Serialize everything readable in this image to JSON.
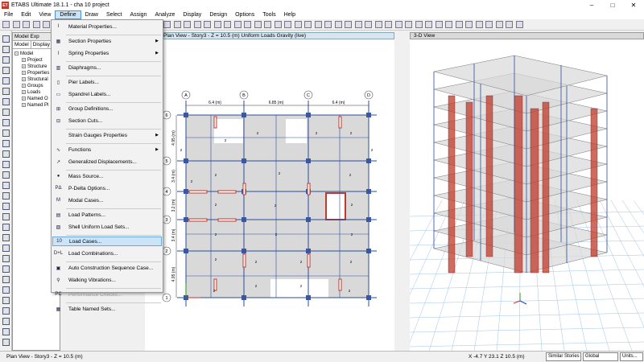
{
  "window": {
    "title": "ETABS Ultimate 18.1.1 - cha 10 project",
    "logo_text": "ET"
  },
  "menubar": [
    "File",
    "Edit",
    "View",
    "Define",
    "Draw",
    "Select",
    "Assign",
    "Analyze",
    "Display",
    "Design",
    "Options",
    "Tools",
    "Help"
  ],
  "model_panel": {
    "title": "Model Exp",
    "tabs": [
      "Model",
      "Display"
    ],
    "tree": [
      "Model",
      "Project",
      "Structure",
      "Properties",
      "Structural",
      "Groups",
      "Loads",
      "Named O",
      "Named Pl"
    ]
  },
  "define_menu": [
    {
      "label": "Material Properties...",
      "icon": "I",
      "submenu": false
    },
    {
      "label": "Section Properties",
      "icon": "▦",
      "submenu": true
    },
    {
      "label": "Spring Properties",
      "icon": "⌇",
      "submenu": true
    },
    {
      "label": "Diaphragms...",
      "icon": "▥",
      "submenu": false
    },
    {
      "label": "Pier Labels...",
      "icon": "▯",
      "submenu": false
    },
    {
      "label": "Spandrel Labels...",
      "icon": "▭",
      "submenu": false
    },
    {
      "label": "Group Definitions...",
      "icon": "⊞",
      "submenu": false
    },
    {
      "label": "Section Cuts...",
      "icon": "⊟",
      "submenu": false
    },
    {
      "label": "Strain Gauges Properties",
      "icon": "",
      "submenu": true
    },
    {
      "label": "Functions",
      "icon": "∿",
      "submenu": true
    },
    {
      "label": "Generalized Displacements...",
      "icon": "↗",
      "submenu": false
    },
    {
      "label": "Mass Source...",
      "icon": "●",
      "submenu": false
    },
    {
      "label": "P-Delta Options...",
      "icon": "PΔ",
      "submenu": false
    },
    {
      "label": "Modal Cases...",
      "icon": "M",
      "submenu": false
    },
    {
      "label": "Load Patterns...",
      "icon": "▤",
      "submenu": false
    },
    {
      "label": "Shell Uniform Load Sets...",
      "icon": "▧",
      "submenu": false
    },
    {
      "label": "Load Cases...",
      "icon": "10",
      "submenu": false
    },
    {
      "label": "Load Combinations...",
      "icon": "D+L",
      "submenu": false
    },
    {
      "label": "Auto Construction Sequence Case...",
      "icon": "▣",
      "submenu": false
    },
    {
      "label": "Walking Vibrations...",
      "icon": "⚲",
      "submenu": false
    },
    {
      "label": "Performance Checks...",
      "icon": "PC",
      "submenu": false
    },
    {
      "label": "Table Named Sets...",
      "icon": "▦",
      "submenu": false
    }
  ],
  "define_menu_highlighted": "Load Cases...",
  "plan_view": {
    "title": "Plan View - Story3 - Z = 10.5 (m)  Uniform Loads Gravity  (live)",
    "grid_x": [
      "A",
      "B",
      "C",
      "D"
    ],
    "grid_y": [
      "6",
      "5",
      "4",
      "3",
      "2",
      "1"
    ],
    "dims_x": [
      "6.4 (m)",
      "6.85 (m)",
      "6.4 (m)"
    ],
    "dims_y": [
      "4.95 (m)",
      "3.4 (m)",
      "3.2 (m)",
      "3.4 (m)",
      "4.95 (m)"
    ],
    "load_value": "2"
  },
  "view3d": {
    "title": "3-D View"
  },
  "statusbar": {
    "left": "Plan View - Story3 - Z = 10.5 (m)",
    "coords": "X -4.7  Y 23.1  Z 10.5 (m)",
    "stories": "Similar Stories",
    "coord_sys": "Global",
    "units": "Units..."
  },
  "colors": {
    "accent": "#cce4f7",
    "wall": "#c0392b",
    "beam": "#2b4c9b",
    "slab": "#d9d9d9"
  }
}
